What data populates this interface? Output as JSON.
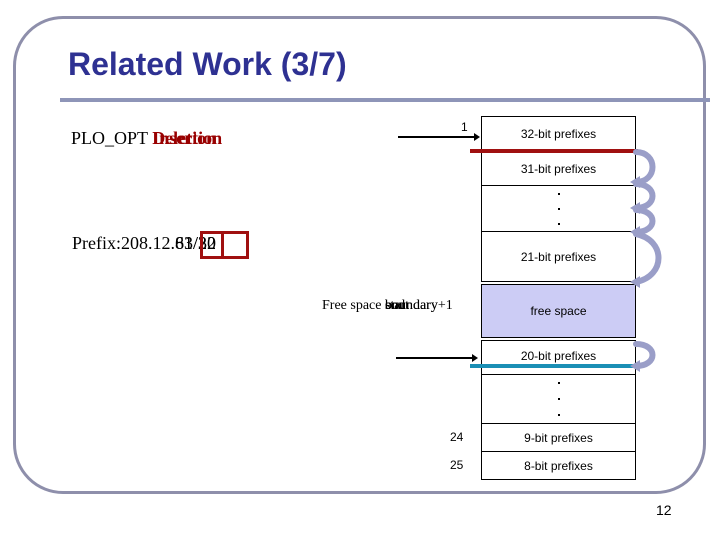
{
  "slide": {
    "title": "Related Work (3/7)",
    "page_number": "12"
  },
  "operation": {
    "prefix_text": "PLO_OPT ",
    "overlapping_words": [
      "Deletion",
      "Insertion"
    ]
  },
  "prefix": {
    "label": "Prefix:208.12.",
    "overlapping_values": [
      "63/20",
      "81/32"
    ],
    "display": "Prefix:208.12.63/20 / 81/32"
  },
  "free_space_label": {
    "prefix_text": "Free space ",
    "overlapping_words": [
      "start",
      "boundary",
      "end",
      "boundary+1"
    ]
  },
  "pointers": [
    {
      "label": "1",
      "target_row": "32-bit prefixes"
    },
    {
      "label": "",
      "target_row": "20-bit prefixes"
    }
  ],
  "table": {
    "rows": [
      {
        "label": "32-bit prefixes",
        "type": "prefix"
      },
      {
        "label": "31-bit prefixes",
        "type": "prefix"
      },
      {
        "label": "...",
        "type": "ellipsis"
      },
      {
        "label": "21-bit prefixes",
        "type": "prefix"
      },
      {
        "label": "free space",
        "type": "free"
      },
      {
        "label": "20-bit prefixes",
        "type": "prefix"
      },
      {
        "label": "...",
        "type": "ellipsis"
      },
      {
        "label": "9-bit prefixes",
        "type": "prefix",
        "index": "24"
      },
      {
        "label": "8-bit prefixes",
        "type": "prefix",
        "index": "25"
      }
    ]
  },
  "colors": {
    "title": "#2e3192",
    "frame": "#8e8fab",
    "highlight_red": "#a01010",
    "deletion_text": "#990000",
    "free_space_fill": "#ccccf5",
    "teal_marker": "#1a8fb5",
    "curl_arrows": "#9a9ec8"
  }
}
